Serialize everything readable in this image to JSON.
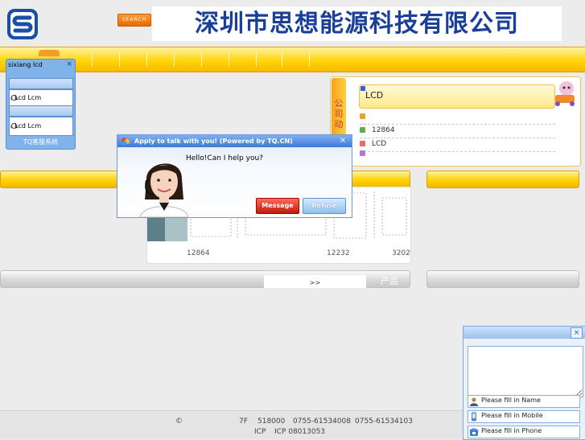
{
  "header": {
    "search_label": "SEARCH",
    "company_name": "深圳市思想能源科技有限公司",
    "logo_icon": "s-logo-icon"
  },
  "tq_panel": {
    "title": "sixiang lcd",
    "close": "×",
    "items": [
      "Lcd Lcm",
      "Lcd Lcm"
    ],
    "footer": "TQ客服系统"
  },
  "news": {
    "side_label": "公司动",
    "heading": "LCD",
    "rows": [
      "",
      "12864",
      "LCD",
      ""
    ]
  },
  "products": {
    "numbers": [
      "12864",
      "12232",
      "3202"
    ],
    "more": ">>",
    "section_label": "产品"
  },
  "footer": {
    "copyright": "©",
    "floor": "7F",
    "postcode": "518000",
    "phone": "0755-61534008",
    "fax": "0755-61534103",
    "icp_label": "ICP",
    "icp_number": "ICP 08013053"
  },
  "chat_dialog": {
    "title": "Apply to talk with you! (Powered by TQ.CN)",
    "close": "×",
    "message": "Hello!Can I help you?",
    "message_button": "Message",
    "refuse_button": "Refuse"
  },
  "contact_form": {
    "close": "×",
    "name_placeholder": "Please fill in Name",
    "mobile_placeholder": "Please fill in Mobile",
    "phone_placeholder": "Please fill in Phone"
  },
  "colors": {
    "accent_yellow": "#ffd200",
    "title_blue": "#1a3f9a",
    "dialog_blue": "#3d79d6",
    "message_red": "#c01a0c"
  }
}
